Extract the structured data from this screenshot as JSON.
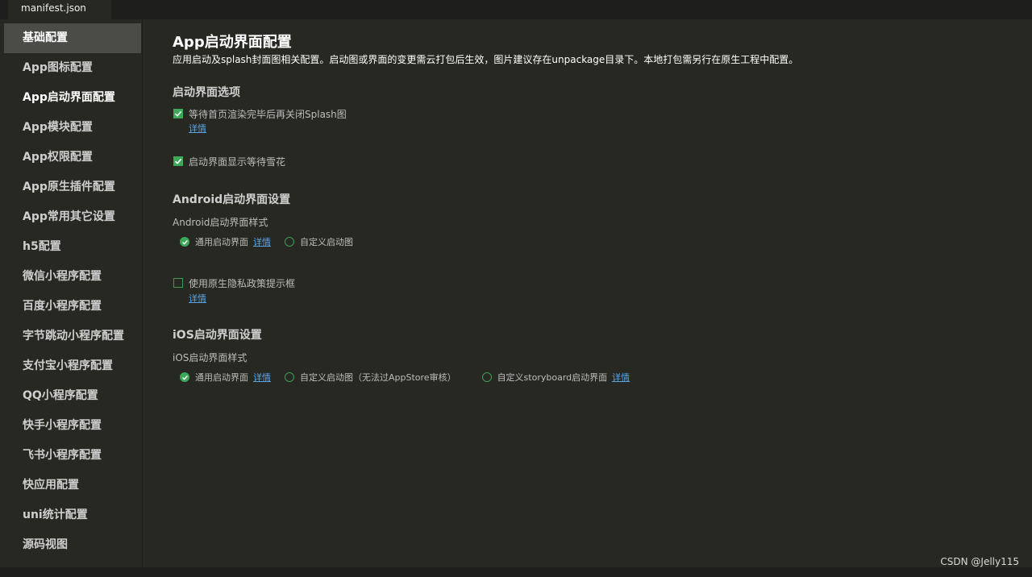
{
  "tab": {
    "title": "manifest.json"
  },
  "sidebar": {
    "items": [
      {
        "label": "基础配置"
      },
      {
        "label": "App图标配置"
      },
      {
        "label": "App启动界面配置"
      },
      {
        "label": "App模块配置"
      },
      {
        "label": "App权限配置"
      },
      {
        "label": "App原生插件配置"
      },
      {
        "label": "App常用其它设置"
      },
      {
        "label": "h5配置"
      },
      {
        "label": "微信小程序配置"
      },
      {
        "label": "百度小程序配置"
      },
      {
        "label": "字节跳动小程序配置"
      },
      {
        "label": "支付宝小程序配置"
      },
      {
        "label": "QQ小程序配置"
      },
      {
        "label": "快手小程序配置"
      },
      {
        "label": "飞书小程序配置"
      },
      {
        "label": "快应用配置"
      },
      {
        "label": "uni统计配置"
      },
      {
        "label": "源码视图"
      }
    ]
  },
  "main": {
    "title": "App启动界面配置",
    "description": "应用启动及splash封面图相关配置。启动图或界面的变更需云打包后生效，图片建议存在unpackage目录下。本地打包需另行在原生工程中配置。",
    "splash_options": {
      "title": "启动界面选项",
      "wait_render": {
        "label": "等待首页渲染完毕后再关闭Splash图",
        "checked": true,
        "link": "详情"
      },
      "show_waiting": {
        "label": "启动界面显示等待雪花",
        "checked": true
      }
    },
    "android": {
      "title": "Android启动界面设置",
      "style_label": "Android启动界面样式",
      "options": [
        {
          "label": "通用启动界面",
          "checked": true,
          "link": "详情"
        },
        {
          "label": "自定义启动图",
          "checked": false
        }
      ],
      "privacy": {
        "label": "使用原生隐私政策提示框",
        "checked": false,
        "link": "详情"
      }
    },
    "ios": {
      "title": "iOS启动界面设置",
      "style_label": "iOS启动界面样式",
      "options": [
        {
          "label": "通用启动界面",
          "checked": true,
          "link": "详情"
        },
        {
          "label": "自定义启动图（无法过AppStore审核）",
          "checked": false
        },
        {
          "label": "自定义storyboard启动界面",
          "checked": false,
          "link": "详情"
        }
      ]
    }
  },
  "watermark": "CSDN @Jelly115",
  "colors": {
    "accent": "#3ea85a",
    "link": "#5aa5e6",
    "background": "#272822"
  }
}
